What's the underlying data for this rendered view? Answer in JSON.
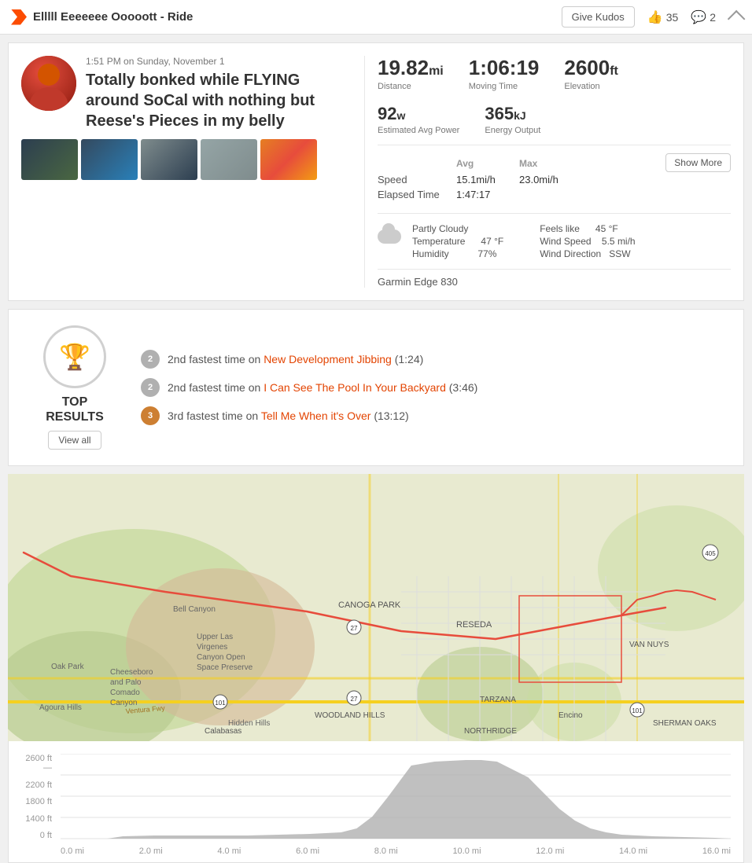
{
  "header": {
    "title": "Elllll Eeeeeee Ooooott - Ride",
    "give_kudos": "Give Kudos",
    "kudos_count": "35",
    "comments_count": "2"
  },
  "activity": {
    "datetime": "1:51 PM on Sunday, November 1",
    "title": "Totally bonked while FLYING around SoCal with nothing but Reese's Pieces in my belly",
    "stats": {
      "distance_value": "19.82",
      "distance_unit": "mi",
      "distance_label": "Distance",
      "moving_time_value": "1:06:19",
      "moving_time_label": "Moving Time",
      "elevation_value": "2600",
      "elevation_unit": "ft",
      "elevation_label": "Elevation",
      "est_avg_power_value": "92",
      "est_avg_power_unit": "w",
      "est_avg_power_label": "Estimated Avg Power",
      "energy_output_value": "365",
      "energy_output_unit": "kJ",
      "energy_output_label": "Energy Output"
    },
    "speed_avg": "15.1mi/h",
    "speed_max": "23.0mi/h",
    "speed_label": "Speed",
    "elapsed_time_label": "Elapsed Time",
    "elapsed_time_value": "1:47:17",
    "col_avg": "Avg",
    "col_max": "Max",
    "show_more": "Show More",
    "weather": {
      "condition": "Partly Cloudy",
      "temperature_label": "Temperature",
      "temperature_value": "47 °F",
      "humidity_label": "Humidity",
      "humidity_value": "77%",
      "feels_like_label": "Feels like",
      "feels_like_value": "45 °F",
      "wind_speed_label": "Wind Speed",
      "wind_speed_value": "5.5 mi/h",
      "wind_direction_label": "Wind Direction",
      "wind_direction_value": "SSW"
    },
    "device": "Garmin Edge 830"
  },
  "top_results": {
    "label": "TOP\nRESULTS",
    "view_all": "View all",
    "results": [
      {
        "medal": "2",
        "medal_type": "silver",
        "text": "2nd fastest time on",
        "segment": "New Development Jibbing",
        "time": "(1:24)"
      },
      {
        "medal": "2",
        "medal_type": "silver",
        "text": "2nd fastest time on",
        "segment": "I Can See The Pool In Your Backyard",
        "time": "(3:46)"
      },
      {
        "medal": "3",
        "medal_type": "bronze",
        "text": "3rd fastest time on",
        "segment": "Tell Me When it's Over",
        "time": "(13:12)"
      }
    ]
  },
  "elevation": {
    "y_labels": [
      "2600 ft —",
      "2200 ft",
      "1800 ft",
      "1400 ft",
      "0 ft"
    ],
    "x_labels": [
      "0.0 mi",
      "2.0 mi",
      "4.0 mi",
      "6.0 mi",
      "8.0 mi",
      "10.0 mi",
      "12.0 mi",
      "14.0 mi",
      "16.0 mi"
    ]
  }
}
